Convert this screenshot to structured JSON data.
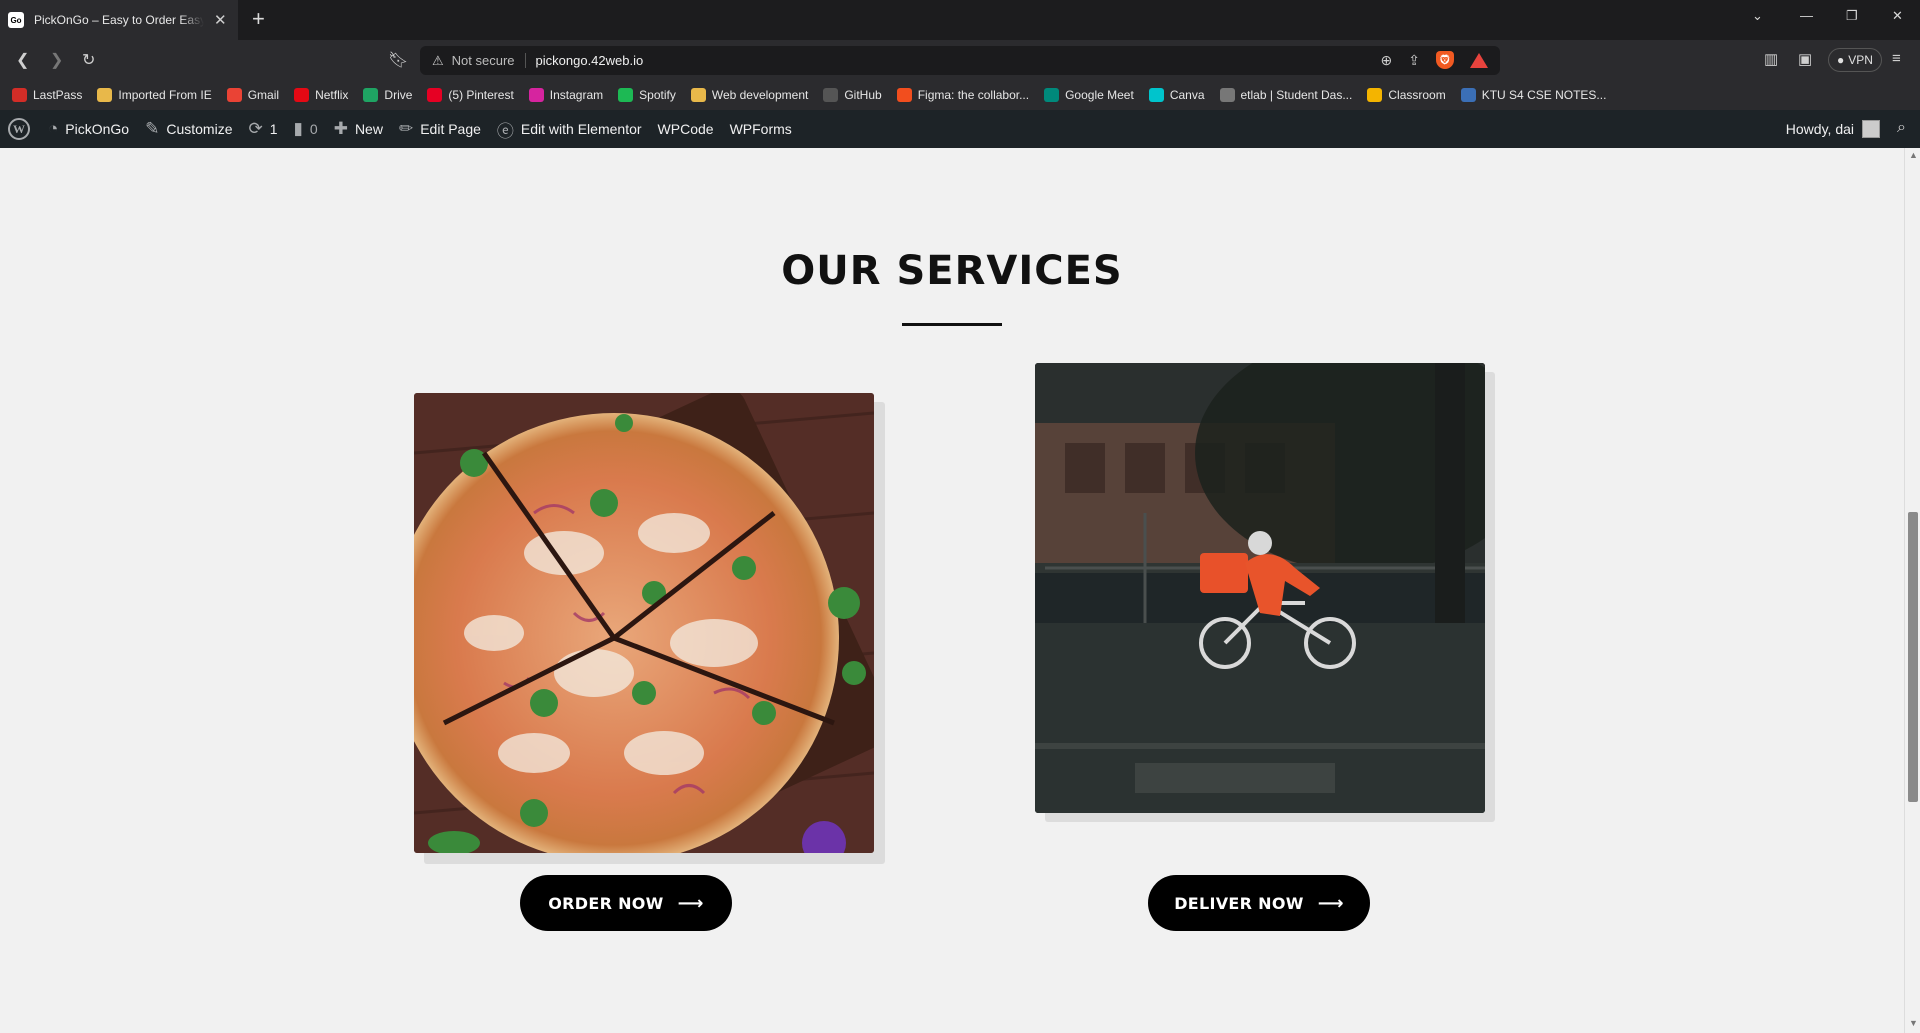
{
  "browser": {
    "tab_title": "PickOnGo – Easy to Order Easy to Deliver",
    "tab_favicon_text": "Go",
    "security_label": "Not secure",
    "url": "pickongo.42web.io",
    "vpn_label": "VPN"
  },
  "bookmarks": [
    {
      "label": "LastPass",
      "icon": "lastpass-icon",
      "color": "#d32d27"
    },
    {
      "label": "Imported From IE",
      "icon": "folder-icon",
      "color": "#e8b84a"
    },
    {
      "label": "Gmail",
      "icon": "gmail-icon",
      "color": "#ea4335"
    },
    {
      "label": "Netflix",
      "icon": "netflix-icon",
      "color": "#e50914"
    },
    {
      "label": "Drive",
      "icon": "drive-icon",
      "color": "#1fa463"
    },
    {
      "label": "(5) Pinterest",
      "icon": "pinterest-icon",
      "color": "#e60023"
    },
    {
      "label": "Instagram",
      "icon": "instagram-icon",
      "color": "#d6249f"
    },
    {
      "label": "Spotify",
      "icon": "spotify-icon",
      "color": "#1db954"
    },
    {
      "label": "Web development",
      "icon": "folder-icon",
      "color": "#e8b84a"
    },
    {
      "label": "GitHub",
      "icon": "github-icon",
      "color": "#555555"
    },
    {
      "label": "Figma: the collabor...",
      "icon": "figma-icon",
      "color": "#f24e1e"
    },
    {
      "label": "Google Meet",
      "icon": "meet-icon",
      "color": "#00897b"
    },
    {
      "label": "Canva",
      "icon": "canva-icon",
      "color": "#00c4cc"
    },
    {
      "label": "etlab | Student Das...",
      "icon": "globe-icon",
      "color": "#777777"
    },
    {
      "label": "Classroom",
      "icon": "classroom-icon",
      "color": "#f4b400"
    },
    {
      "label": "KTU S4 CSE NOTES...",
      "icon": "ktu-icon",
      "color": "#3b6fb6"
    }
  ],
  "admin_bar": {
    "site_name": "PickOnGo",
    "customize": "Customize",
    "updates_count": "1",
    "comments_count": "0",
    "new": "New",
    "edit_page": "Edit Page",
    "edit_elementor": "Edit with Elementor",
    "wpcode": "WPCode",
    "wpforms": "WPForms",
    "howdy": "Howdy, dai"
  },
  "services": {
    "heading": "OUR SERVICES",
    "order_button": "ORDER NOW",
    "deliver_button": "DELIVER NOW",
    "arrow": "⟶"
  },
  "colors": {
    "accent": "#000000",
    "background": "#f1f1f1",
    "admin_bar": "#1d2327"
  }
}
